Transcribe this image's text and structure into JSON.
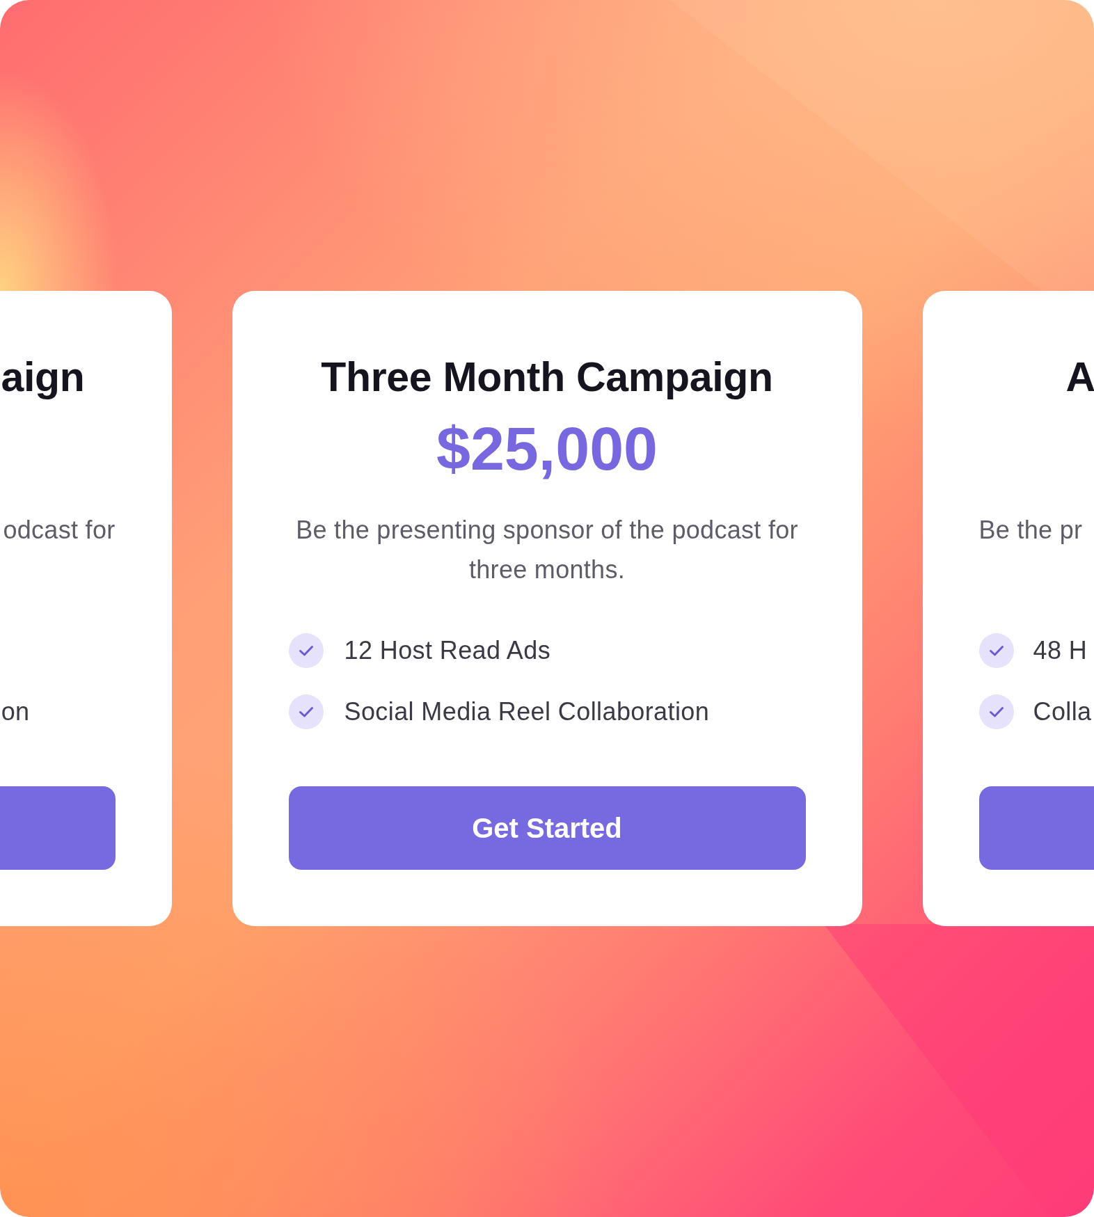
{
  "cards": [
    {
      "kind": "clipped-left",
      "title": "aign",
      "description": "odcast for",
      "features": [
        {
          "text": "on"
        }
      ],
      "button": true
    },
    {
      "kind": "full",
      "title": "Three Month Campaign",
      "price": "$25,000",
      "description": "Be the presenting sponsor of the podcast for three months.",
      "features": [
        {
          "text": "12 Host Read Ads"
        },
        {
          "text": "Social Media Reel Collaboration"
        }
      ],
      "button": true,
      "button_label": "Get Started"
    },
    {
      "kind": "clipped-right",
      "title": "A",
      "description": "Be the pr",
      "features": [
        {
          "text": "48 H"
        },
        {
          "text": "Colla"
        }
      ],
      "button": true
    }
  ]
}
